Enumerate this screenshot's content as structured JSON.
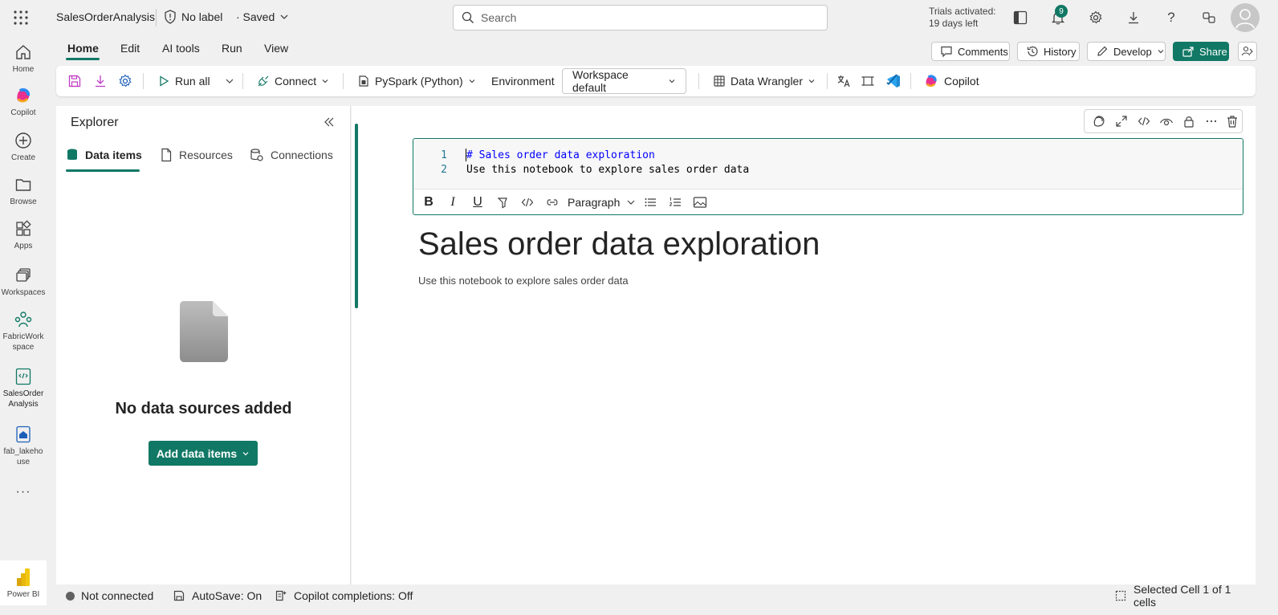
{
  "app": {
    "name": "SalesOrderAnalysis",
    "sensitivity": "No label",
    "save_state": "· Saved"
  },
  "search": {
    "placeholder": "Search"
  },
  "trial": {
    "line1": "Trials activated:",
    "line2": "19 days left"
  },
  "notifications": {
    "count": "9"
  },
  "rail": {
    "home": "Home",
    "copilot": "Copilot",
    "create": "Create",
    "browse": "Browse",
    "apps": "Apps",
    "workspaces": "Workspaces",
    "fabric_workspace": "FabricWorkspace",
    "sales_order": "SalesOrderAnalysis",
    "lakehouse": "fab_lakehouse",
    "more": "···",
    "powerbi": "Power BI"
  },
  "ribbon": {
    "tabs": [
      "Home",
      "Edit",
      "AI tools",
      "Run",
      "View"
    ],
    "active_tab": "Home",
    "comments": "Comments",
    "history": "History",
    "develop": "Develop",
    "share": "Share"
  },
  "toolbar": {
    "run_all": "Run all",
    "connect": "Connect",
    "language": "PySpark (Python)",
    "environment_label": "Environment",
    "environment_value": "Workspace default",
    "data_wrangler": "Data Wrangler",
    "copilot": "Copilot"
  },
  "explorer": {
    "title": "Explorer",
    "tabs": [
      "Data items",
      "Resources",
      "Connections"
    ],
    "empty_message": "No data sources added",
    "add_button": "Add data items"
  },
  "cell": {
    "lines": [
      {
        "number": "1",
        "text": "# Sales order data exploration"
      },
      {
        "number": "2",
        "text": "Use this notebook to explore sales order data"
      }
    ],
    "format_style": "Paragraph",
    "fmt_bold": "B",
    "fmt_italic": "I",
    "fmt_underline": "U",
    "rendered_heading": "Sales order data exploration",
    "rendered_body": "Use this notebook to explore sales order data"
  },
  "status": {
    "connection": "Not connected",
    "autosave": "AutoSave: On",
    "copilot_completions": "Copilot completions: Off",
    "selection": "Selected Cell 1 of 1 cells"
  },
  "colors": {
    "accent": "#117865",
    "code_link": "#0000ff",
    "line_number": "#237893"
  }
}
